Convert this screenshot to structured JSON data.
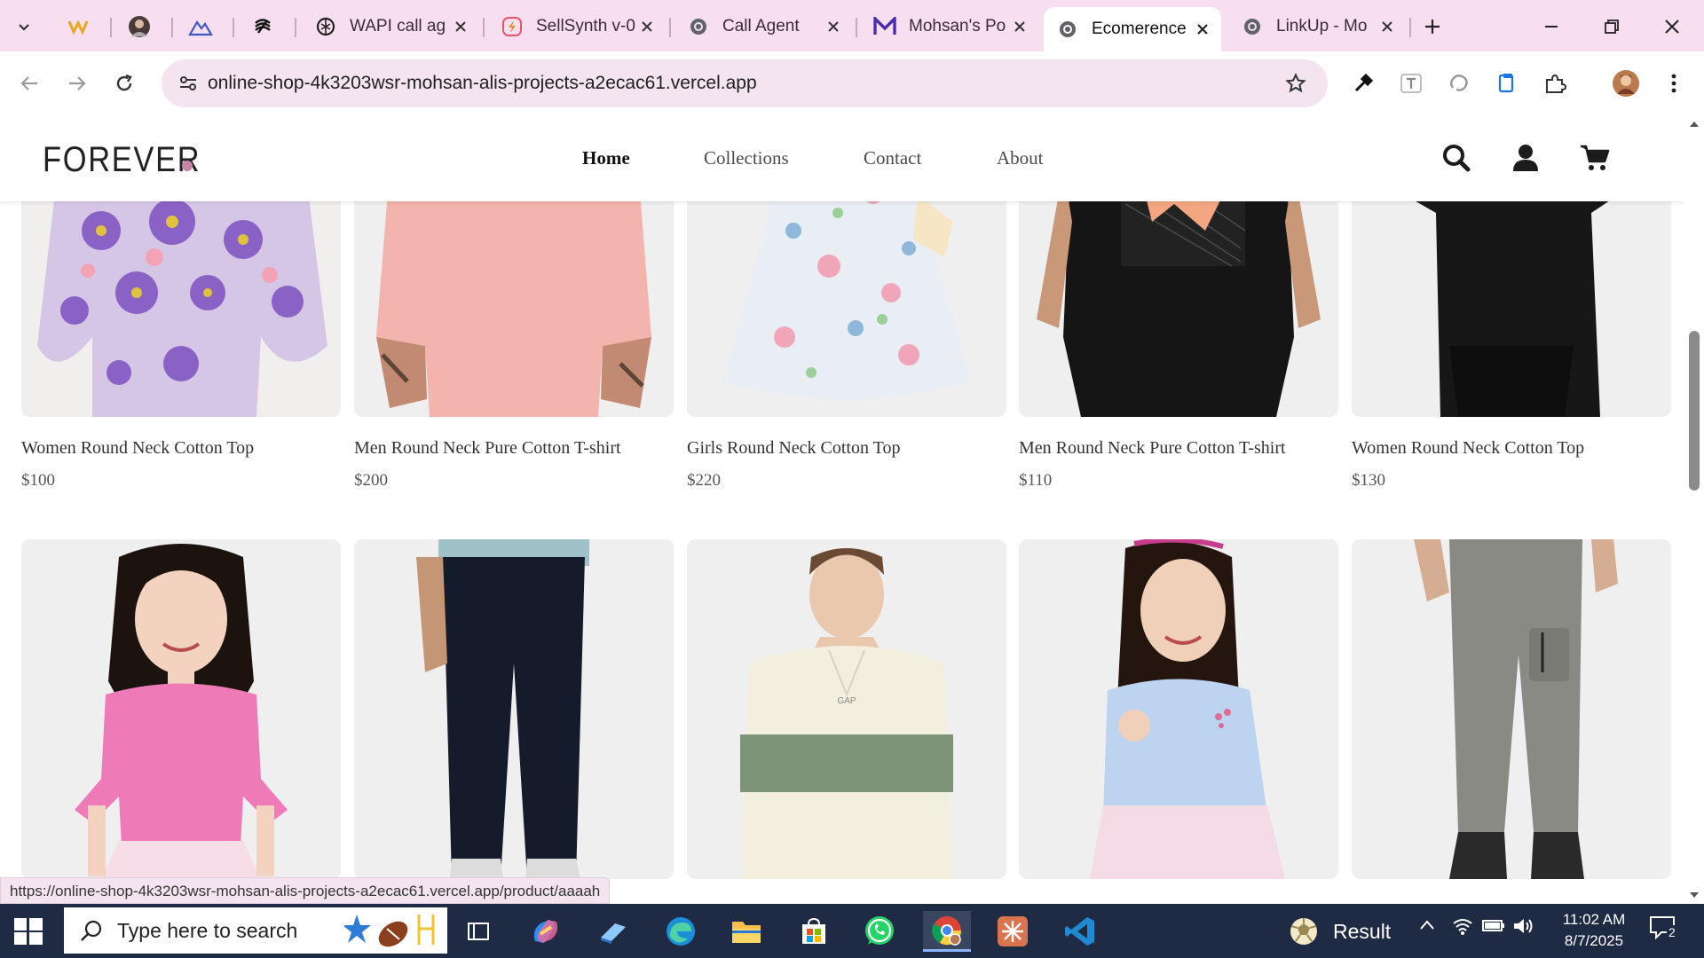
{
  "browser": {
    "tabs": [
      {
        "title": "WAPI call ag",
        "favicon": "openai-icon"
      },
      {
        "title": "SellSynth v-0",
        "favicon": "sellsynth-icon"
      },
      {
        "title": "Call Agent",
        "favicon": "globe-icon"
      },
      {
        "title": "Mohsan's Po",
        "favicon": "m-logo-icon"
      },
      {
        "title": "Ecomerence",
        "favicon": "globe-icon",
        "active": true
      },
      {
        "title": "LinkUp - Mo",
        "favicon": "globe-icon"
      }
    ],
    "url": "online-shop-4k3203wsr-mohsan-alis-projects-a2ecac61.vercel.app",
    "status_url": "https://online-shop-4k3203wsr-mohsan-alis-projects-a2ecac61.vercel.app/product/aaaah"
  },
  "site": {
    "logo": "FOREVER",
    "nav": [
      "Home",
      "Collections",
      "Contact",
      "About"
    ],
    "active_nav": "Home"
  },
  "products": [
    {
      "name": "Women Round Neck Cotton Top",
      "price": "$100"
    },
    {
      "name": "Men Round Neck Pure Cotton T-shirt",
      "price": "$200"
    },
    {
      "name": "Girls Round Neck Cotton Top",
      "price": "$220"
    },
    {
      "name": "Men Round Neck Pure Cotton T-shirt",
      "price": "$110"
    },
    {
      "name": "Women Round Neck Cotton Top",
      "price": "$130"
    }
  ],
  "products_row2": [
    {
      "image": "girl-pink-top"
    },
    {
      "image": "men-dark-jeans"
    },
    {
      "image": "striped-polo-sweater"
    },
    {
      "image": "girl-blue-top"
    },
    {
      "image": "grey-cargo-joggers"
    }
  ],
  "taskbar": {
    "search_placeholder": "Type here to search",
    "weather_label": "Result",
    "time": "11:02 AM",
    "date": "8/7/2025",
    "notification_count": "2"
  }
}
